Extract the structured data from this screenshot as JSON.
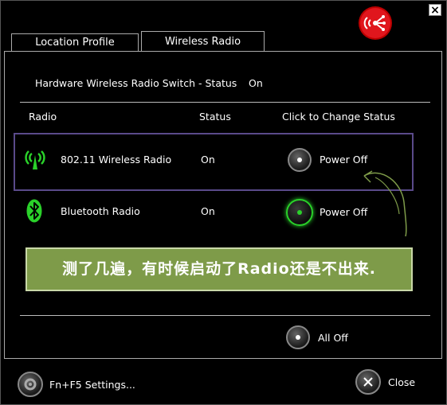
{
  "window": {
    "close_glyph": "×"
  },
  "tabs": [
    {
      "label": "Location Profile"
    },
    {
      "label": "Wireless Radio"
    }
  ],
  "hardware_switch": {
    "label": "Hardware Wireless Radio Switch - Status",
    "value": "On"
  },
  "table": {
    "headers": {
      "radio": "Radio",
      "status": "Status",
      "action": "Click to Change Status"
    },
    "rows": [
      {
        "name": "802.11 Wireless Radio",
        "status": "On",
        "action": "Power Off",
        "icon": "wifi-antenna-icon"
      },
      {
        "name": "Bluetooth Radio",
        "status": "On",
        "action": "Power Off",
        "icon": "bluetooth-icon"
      }
    ]
  },
  "annotation": {
    "text": "测了几遍，有时候启动了Radio还是不出来."
  },
  "all_off": {
    "label": "All Off"
  },
  "footer": {
    "settings_label": "Fn+F5 Settings...",
    "close_label": "Close"
  },
  "colors": {
    "accent_green": "#2ad12a",
    "logo_red": "#e0161d",
    "annotation_bg": "#7e9b49",
    "highlight_border": "#5a4a8a"
  }
}
